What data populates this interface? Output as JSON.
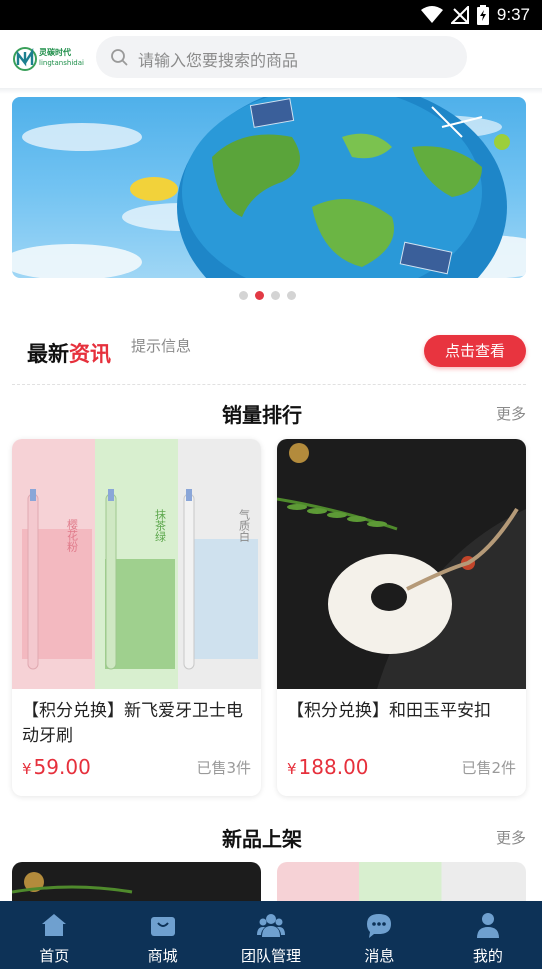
{
  "status_bar": {
    "time": "9:37"
  },
  "header": {
    "logo_cn": "灵碳时代",
    "logo_en": "lingtanshidai",
    "search_placeholder": "请输入您要搜索的商品"
  },
  "banner": {
    "dots": 4,
    "active_dot": 1
  },
  "news": {
    "title_black": "最新",
    "title_red": "资讯",
    "hint": "提示信息",
    "button": "点击查看"
  },
  "sales_rank": {
    "title": "销量排行",
    "more": "更多",
    "items": [
      {
        "title": "【积分兑换】新飞爱牙卫士电动牙刷",
        "currency": "¥",
        "price": "59.00",
        "sold": "已售3件",
        "brush_labels": [
          "樱花粉",
          "抹茶绿",
          "气质白"
        ]
      },
      {
        "title": "【积分兑换】和田玉平安扣",
        "currency": "¥",
        "price": "188.00",
        "sold": "已售2件"
      }
    ]
  },
  "new_arrivals": {
    "title": "新品上架",
    "more": "更多"
  },
  "tabbar": {
    "items": [
      {
        "label": "首页",
        "icon": "home-icon"
      },
      {
        "label": "商城",
        "icon": "shop-icon"
      },
      {
        "label": "团队管理",
        "icon": "team-icon"
      },
      {
        "label": "消息",
        "icon": "message-icon"
      },
      {
        "label": "我的",
        "icon": "user-icon"
      }
    ]
  },
  "colors": {
    "accent": "#e6303c",
    "tabbar": "#0d3257"
  }
}
